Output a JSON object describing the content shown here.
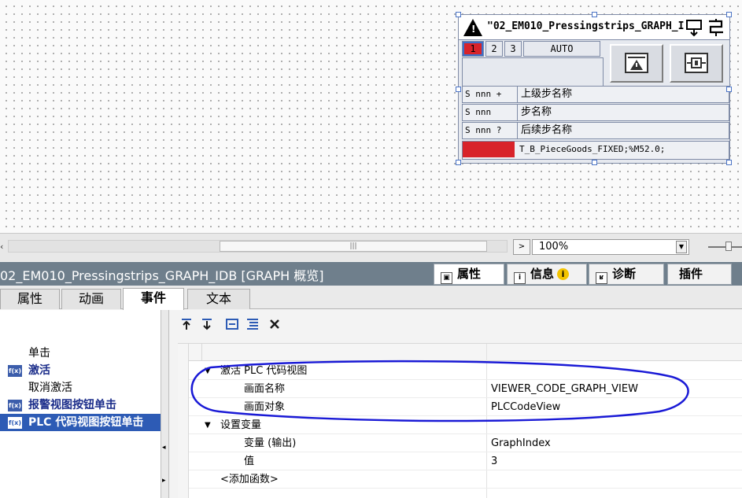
{
  "faceplate": {
    "title": "\"02_EM010_Pressingstrips_GRAPH_IDB",
    "tabs": [
      "1",
      "2",
      "3",
      "AUTO"
    ],
    "active_tab": "1",
    "rows": [
      {
        "left": "S nnn +",
        "right": "上级步名称"
      },
      {
        "left": "S nnn",
        "right": "步名称"
      },
      {
        "left": "S nnn ?",
        "right": "后续步名称"
      }
    ],
    "status_text": "T_B_PieceGoods_FIXED;%M52.0;",
    "status_color": "#d8232a",
    "icons": [
      "warning-icon",
      "download-icon",
      "network-icon",
      "alarm-view-icon",
      "plc-code-icon"
    ]
  },
  "zoom": {
    "value": "100%"
  },
  "inspector": {
    "title": "02_EM010_Pressingstrips_GRAPH_IDB [GRAPH 概览]",
    "tabs": {
      "properties": "属性",
      "info": "信息",
      "diagnostics": "诊断",
      "plugins": "插件"
    },
    "subtabs": [
      "属性",
      "动画",
      "事件",
      "文本"
    ],
    "active_subtab": "事件"
  },
  "events": [
    {
      "label": "单击",
      "has_icon": false,
      "bold": false
    },
    {
      "label": "激活",
      "has_icon": true,
      "bold": true
    },
    {
      "label": "取消激活",
      "has_icon": false,
      "bold": false
    },
    {
      "label": "报警视图按钮单击",
      "has_icon": true,
      "bold": true
    },
    {
      "label": "PLC 代码视图按钮单击",
      "has_icon": true,
      "bold": true,
      "selected": true
    }
  ],
  "event_icon_label": "f(x)",
  "toolbar": {
    "icons": [
      "move-up-icon",
      "move-down-icon",
      "collapse-icon",
      "expand-icon",
      "delete-icon"
    ]
  },
  "functions": [
    {
      "name": "激活 PLC 代码视图",
      "level": 0,
      "expanded": true,
      "value": ""
    },
    {
      "name": "画面名称",
      "level": 1,
      "value": "VIEWER_CODE_GRAPH_VIEW"
    },
    {
      "name": "画面对象",
      "level": 1,
      "value": "PLCCodeView"
    },
    {
      "name": "设置变量",
      "level": 0,
      "expanded": true,
      "value": ""
    },
    {
      "name": "变量 (输出)",
      "level": 1,
      "value": "GraphIndex"
    },
    {
      "name": "值",
      "level": 1,
      "value": "3"
    },
    {
      "name": "<添加函数>",
      "level": 0,
      "value": ""
    }
  ],
  "colors": {
    "accent": "#2d5bb5",
    "header": "#6f7f8c",
    "annotation": "#1a1ad6"
  }
}
